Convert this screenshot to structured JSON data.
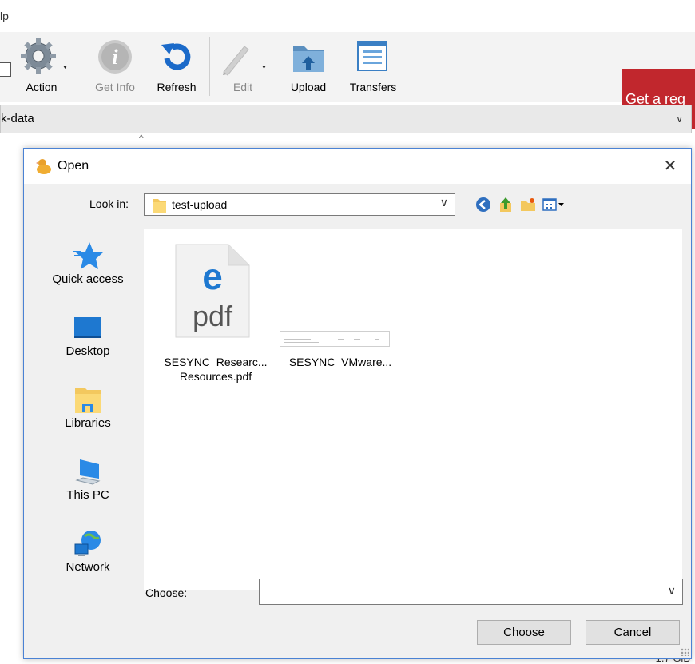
{
  "app": {
    "menu_fragment": "lp",
    "toolbar": {
      "action_label": "Action",
      "get_info_label": "Get Info",
      "refresh_label": "Refresh",
      "edit_label": "Edit",
      "upload_label": "Upload",
      "transfers_label": "Transfers"
    },
    "banner_text": "Get a reg",
    "path_text": "k-data",
    "status_fragment": "1.7 GiB"
  },
  "dialog": {
    "title": "Open",
    "look_in_label": "Look in:",
    "look_in_value": "test-upload",
    "places": [
      {
        "label": "Quick access",
        "icon": "star-icon"
      },
      {
        "label": "Desktop",
        "icon": "desktop-icon"
      },
      {
        "label": "Libraries",
        "icon": "libraries-icon"
      },
      {
        "label": "This PC",
        "icon": "computer-icon"
      },
      {
        "label": "Network",
        "icon": "network-icon"
      }
    ],
    "files": [
      {
        "line1": "SESYNC_Researc...",
        "line2": "Resources.pdf",
        "icon": "pdf-file-icon"
      },
      {
        "line1": "SESYNC_VMware...",
        "line2": "",
        "icon": "spreadsheet-thumbnail"
      }
    ],
    "pdf_icon_text": "pdf",
    "choose_label": "Choose:",
    "choose_value": "",
    "choose_button": "Choose",
    "cancel_button": "Cancel"
  },
  "colors": {
    "banner": "#c1272d",
    "dialog_border": "#4a82d4",
    "edge_blue": "#1e78d0"
  }
}
